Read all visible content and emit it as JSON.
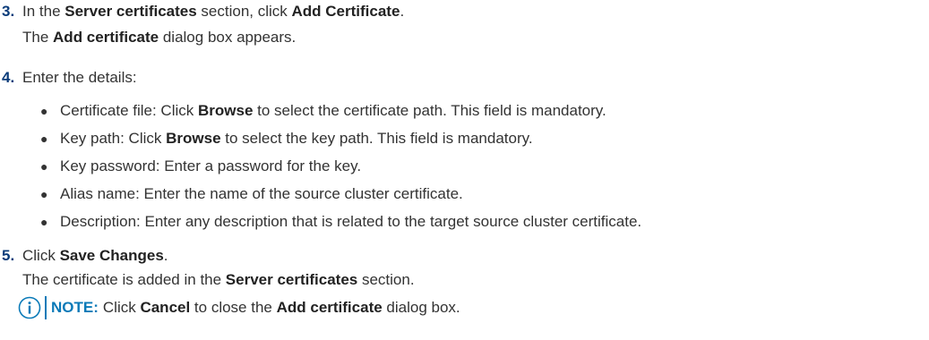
{
  "steps": [
    {
      "number": "3.",
      "lines": [
        {
          "parts": [
            {
              "t": "In the ",
              "b": false
            },
            {
              "t": "Server certificates",
              "b": true
            },
            {
              "t": " section, click ",
              "b": false
            },
            {
              "t": "Add Certificate",
              "b": true
            },
            {
              "t": ".",
              "b": false
            }
          ]
        },
        {
          "parts": [
            {
              "t": "The ",
              "b": false
            },
            {
              "t": "Add certificate",
              "b": true
            },
            {
              "t": " dialog box appears.",
              "b": false
            }
          ]
        }
      ]
    },
    {
      "number": "4.",
      "lines": [
        {
          "parts": [
            {
              "t": "Enter the details:",
              "b": false
            }
          ]
        }
      ],
      "bullets": [
        {
          "parts": [
            {
              "t": "Certificate file: Click ",
              "b": false
            },
            {
              "t": "Browse",
              "b": true
            },
            {
              "t": " to select the certificate path. This field is mandatory.",
              "b": false
            }
          ]
        },
        {
          "parts": [
            {
              "t": "Key path: Click ",
              "b": false
            },
            {
              "t": "Browse",
              "b": true
            },
            {
              "t": " to select the key path. This field is mandatory.",
              "b": false
            }
          ]
        },
        {
          "parts": [
            {
              "t": "Key password: Enter a password for the key.",
              "b": false
            }
          ]
        },
        {
          "parts": [
            {
              "t": "Alias name: Enter the name of the source cluster certificate.",
              "b": false
            }
          ]
        },
        {
          "parts": [
            {
              "t": "Description: Enter any description that is related to the target source cluster certificate.",
              "b": false
            }
          ]
        }
      ]
    },
    {
      "number": "5.",
      "lines": [
        {
          "parts": [
            {
              "t": "Click ",
              "b": false
            },
            {
              "t": "Save Changes",
              "b": true
            },
            {
              "t": ".",
              "b": false
            }
          ]
        },
        {
          "parts": [
            {
              "t": "The certificate is added in the ",
              "b": false
            },
            {
              "t": "Server certificates",
              "b": true
            },
            {
              "t": " section.",
              "b": false
            }
          ]
        }
      ]
    }
  ],
  "note": {
    "icon": "info-icon",
    "label": "NOTE:",
    "parts": [
      {
        "t": " Click ",
        "b": false
      },
      {
        "t": "Cancel",
        "b": true
      },
      {
        "t": " to close the ",
        "b": false
      },
      {
        "t": "Add certificate",
        "b": true
      },
      {
        "t": " dialog box.",
        "b": false
      }
    ]
  },
  "colors": {
    "step_number": "#0b3c7a",
    "note_accent": "#0a7ab8",
    "text": "#333333"
  }
}
